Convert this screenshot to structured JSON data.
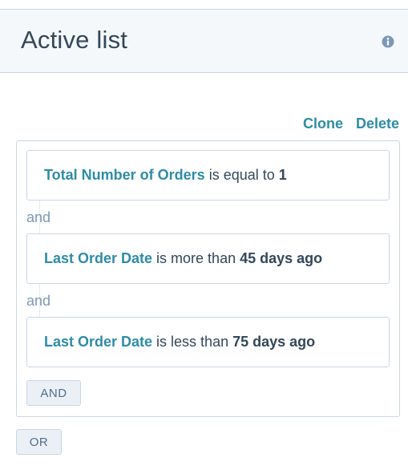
{
  "header": {
    "title": "Active list",
    "info_icon": "info-icon"
  },
  "actions": {
    "clone_label": "Clone",
    "delete_label": "Delete"
  },
  "filters": [
    {
      "property": "Total Number of Orders",
      "operator": " is equal to ",
      "value": "1"
    },
    {
      "property": "Last Order Date",
      "operator": " is more than ",
      "value": "45 days ago"
    },
    {
      "property": "Last Order Date",
      "operator": " is less than ",
      "value": "75 days ago"
    }
  ],
  "connectors": [
    "and",
    "and"
  ],
  "buttons": {
    "and_label": "AND",
    "or_label": "OR"
  },
  "colors": {
    "link": "#2e8ca7",
    "text": "#33475b",
    "header_bg": "#f5f8fa",
    "border": "#cbd6e2",
    "button_bg": "#eaf0f6"
  }
}
